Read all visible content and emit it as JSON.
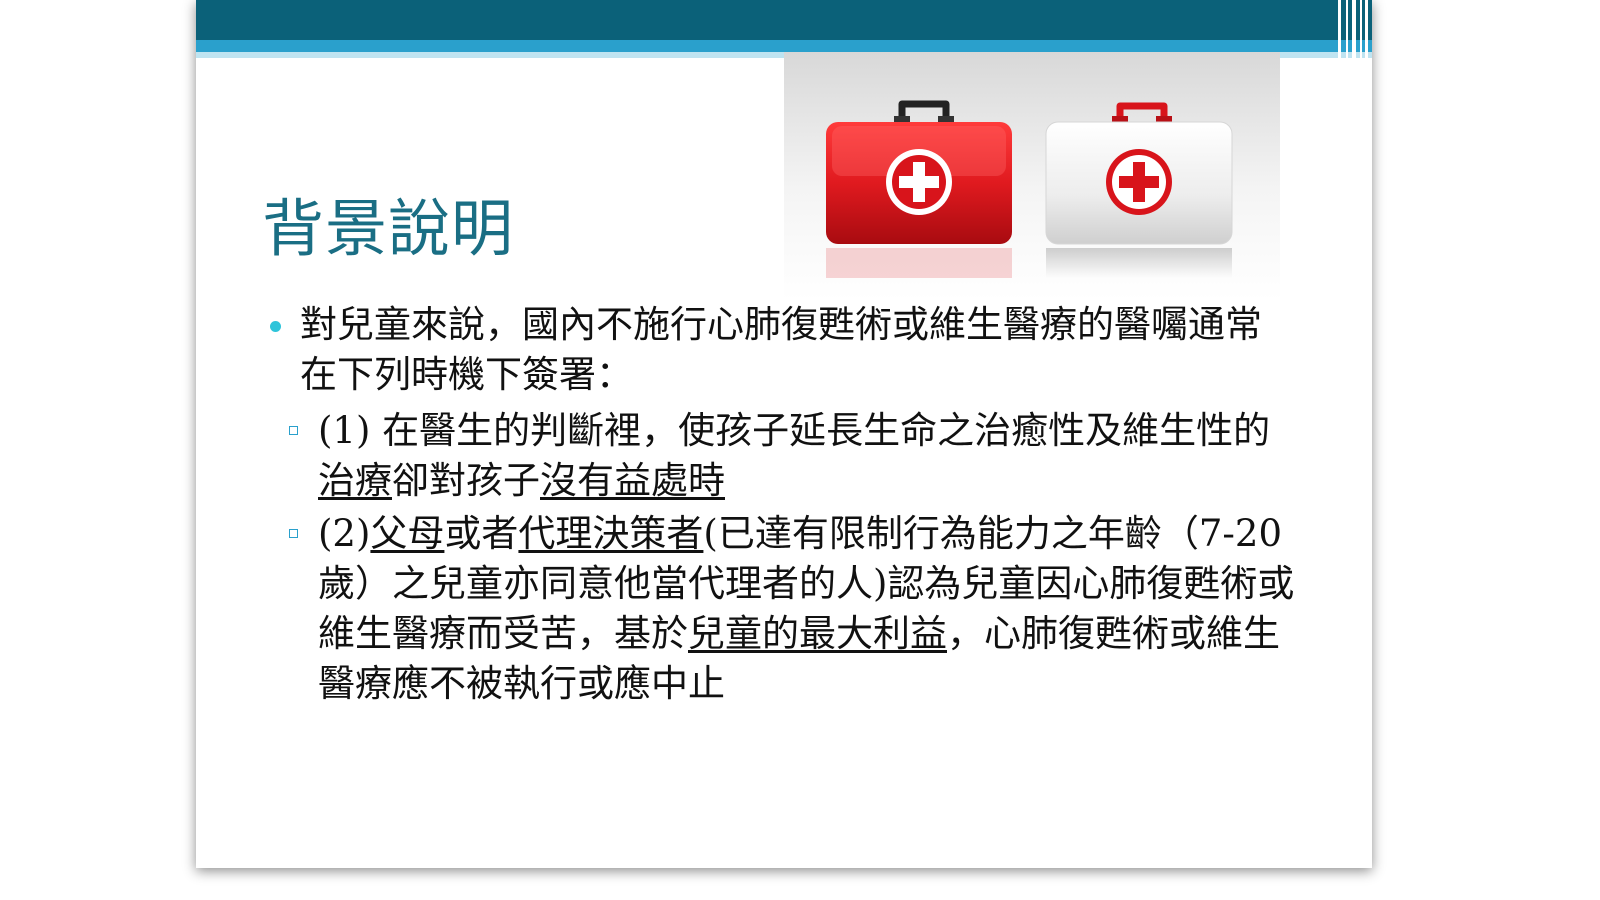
{
  "slide": {
    "title": "背景說明",
    "bullet1": "對兒童來說，國內不施行心肺復甦術或維生醫療的醫囑通常在下列時機下簽署：",
    "sub1": {
      "part1": "(1) 在醫生的判斷裡，使孩子延長生命之治癒性及維生性的",
      "u1": "治療",
      "part2": "卻對孩子",
      "u2": "沒有益處時"
    },
    "sub2": {
      "part1": "(2)",
      "u1": "父母",
      "part2": "或者",
      "u2": "代理決策者",
      "part3": "(已達有限制行為能力之年齡（7-20 歲）之兒童亦同意他當代理者的人)認為兒童因心肺復甦術或維生醫療而受苦，基於",
      "u3": "兒童的最大利益",
      "part4": "，心肺復甦術或維生醫療應不被執行或應中止"
    },
    "image": {
      "icon": "first-aid-kits-icon"
    }
  },
  "colors": {
    "title": "#1a6e84",
    "band": "#0b6179",
    "accent": "#2aa0cc",
    "kit_red": "#d8141b",
    "kit_white": "#f2f2f2"
  }
}
